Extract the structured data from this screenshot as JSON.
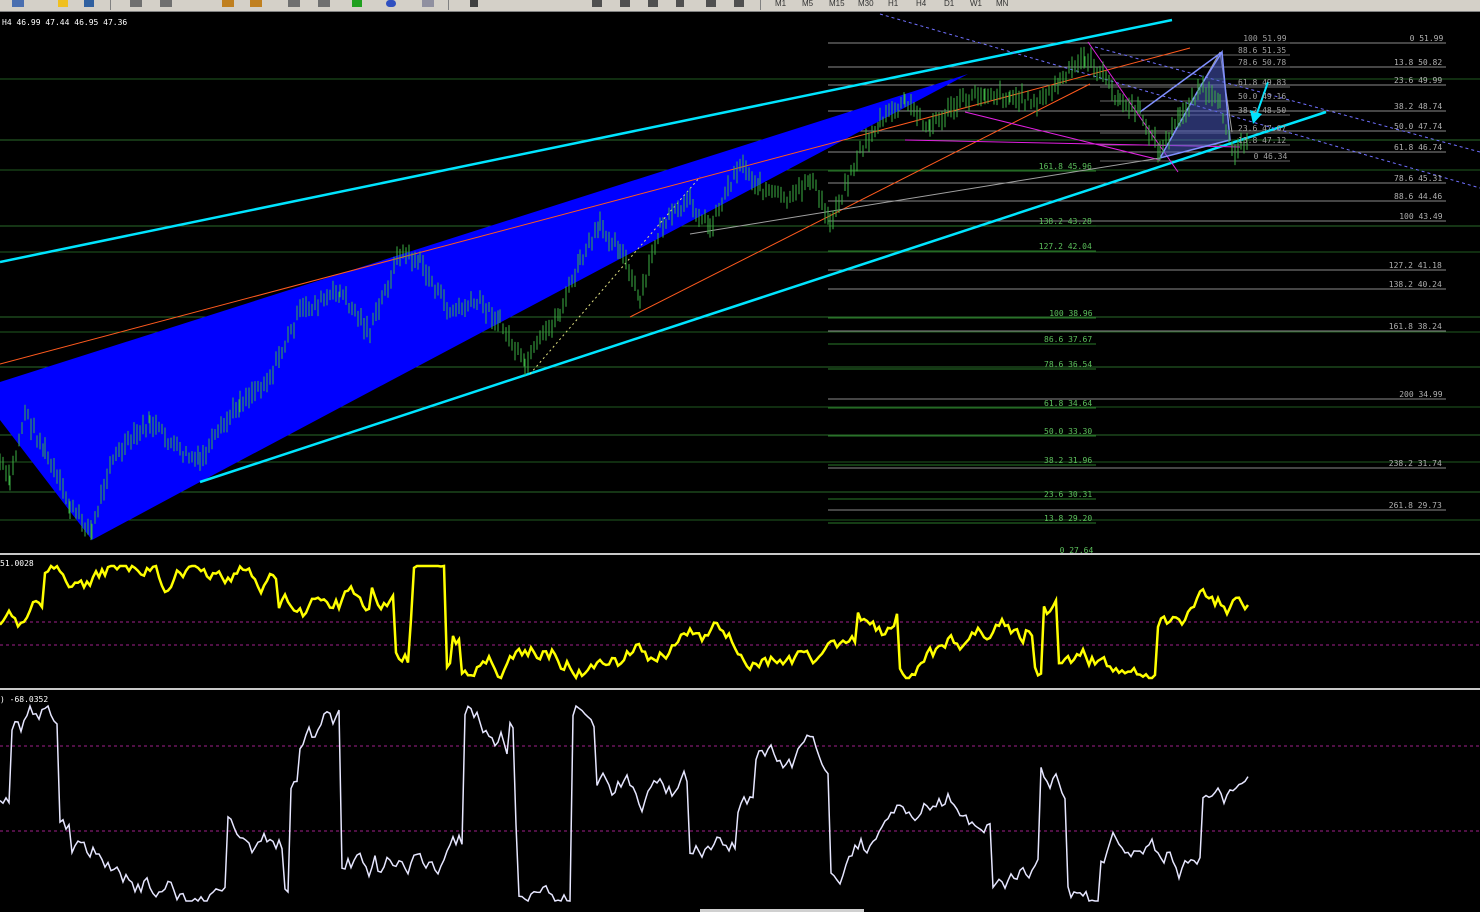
{
  "toolbar": {
    "timeframes": [
      "M1",
      "M5",
      "M15",
      "M30",
      "H1",
      "H4",
      "D1",
      "W1",
      "MN"
    ]
  },
  "main_chart": {
    "info": "H4  46.99 47.44 46.95 47.36",
    "colors": {
      "background": "#000000",
      "candles": "#3cb043",
      "channel": "#00e5ff",
      "fill": "#0000ff",
      "orange": "#ff5a1e",
      "magenta": "#e020e0",
      "fib": "#aaaaaa"
    },
    "fib_left": [
      "100 38.96",
      "86.6 37.67",
      "78.6 36.54",
      "61.8 34.64",
      "50.0 33.30",
      "38.2 31.96",
      "23.6 30.31",
      "13.8 29.20",
      "0 27.64",
      "161.8 45.96",
      "138.2 43.28",
      "127.2 42.04"
    ],
    "fib_right": [
      "0 51.99",
      "13.8 50.82",
      "23.6 49.99",
      "38.2 48.74",
      "50.0 47.74",
      "61.8 46.74",
      "78.6 45.31",
      "88.6 44.46",
      "100 43.49",
      "127.2 41.18",
      "138.2 40.24",
      "161.8 38.24",
      "200 34.99",
      "238.2 31.74",
      "261.8 29.73"
    ],
    "fib_top": [
      "100 51.99",
      "88.6 51.35",
      "78.6 50.78",
      "61.8 49.83",
      "50.0 49.16",
      "38.2 48.50",
      "23.6 47.67",
      "13.8 47.12",
      "0 46.34"
    ]
  },
  "indicator1": {
    "label": "51.0028",
    "color": "#ffff00"
  },
  "indicator2": {
    "label": ") -68.0352",
    "color": "#e6e6ff"
  }
}
